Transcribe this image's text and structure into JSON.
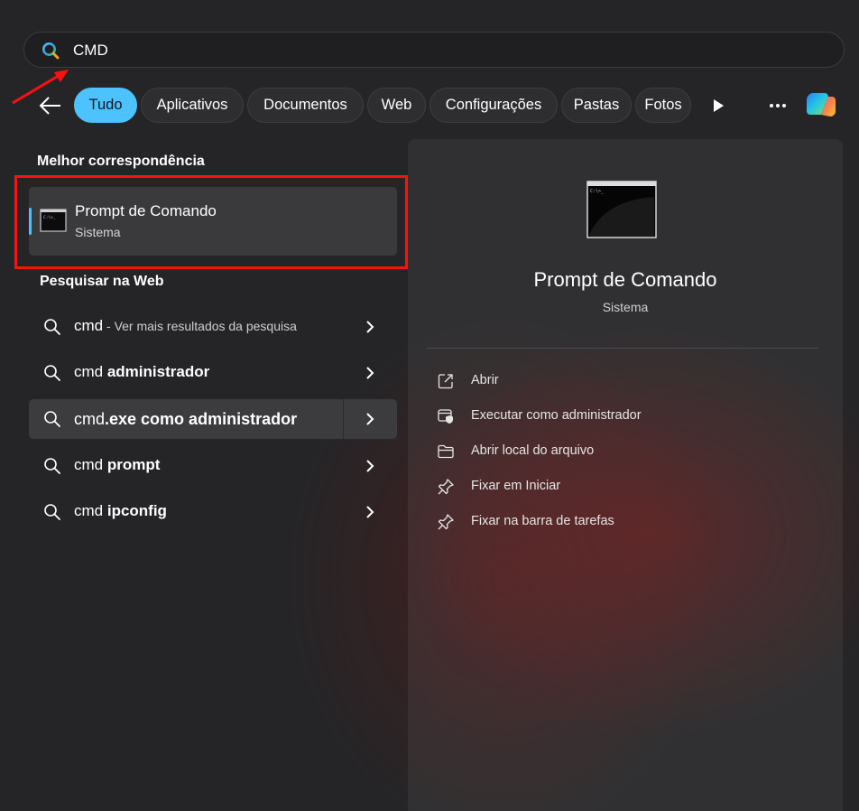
{
  "search": {
    "query": "CMD",
    "icon": "search-icon"
  },
  "filters": {
    "back_icon": "back-arrow-icon",
    "chips": [
      {
        "label": "Tudo",
        "active": true
      },
      {
        "label": "Aplicativos",
        "active": false
      },
      {
        "label": "Documentos",
        "active": false
      },
      {
        "label": "Web",
        "active": false
      },
      {
        "label": "Configurações",
        "active": false
      },
      {
        "label": "Pastas",
        "active": false
      },
      {
        "label": "Fotos",
        "active": false
      }
    ],
    "more_icon": "ellipsis-icon",
    "play_icon": "play-icon",
    "copilot_icon": "copilot-icon"
  },
  "best_match": {
    "section_label": "Melhor correspondência",
    "title": "Prompt de Comando",
    "subtitle": "Sistema",
    "icon": "command-prompt-icon"
  },
  "web": {
    "section_label": "Pesquisar na Web",
    "results": [
      {
        "prefix": "cmd",
        "bold": "",
        "muted": " - Ver mais resultados da pesquisa"
      },
      {
        "prefix": "cmd ",
        "bold": "administrador",
        "muted": ""
      },
      {
        "prefix": "cmd",
        "bold": ".exe como administrador",
        "muted": ""
      },
      {
        "prefix": "cmd ",
        "bold": "prompt",
        "muted": ""
      },
      {
        "prefix": "cmd ",
        "bold": "ipconfig",
        "muted": ""
      }
    ]
  },
  "detail": {
    "title": "Prompt de Comando",
    "subtitle": "Sistema",
    "actions": [
      {
        "label": "Abrir",
        "icon": "open-external-icon"
      },
      {
        "label": "Executar como administrador",
        "icon": "run-as-admin-icon"
      },
      {
        "label": "Abrir local do arquivo",
        "icon": "folder-icon"
      },
      {
        "label": "Fixar em Iniciar",
        "icon": "pin-icon"
      },
      {
        "label": "Fixar na barra de tarefas",
        "icon": "pin-icon"
      }
    ]
  },
  "colors": {
    "accent": "#4cc2ff",
    "annotation": "#ff1010",
    "background": "#252527"
  }
}
